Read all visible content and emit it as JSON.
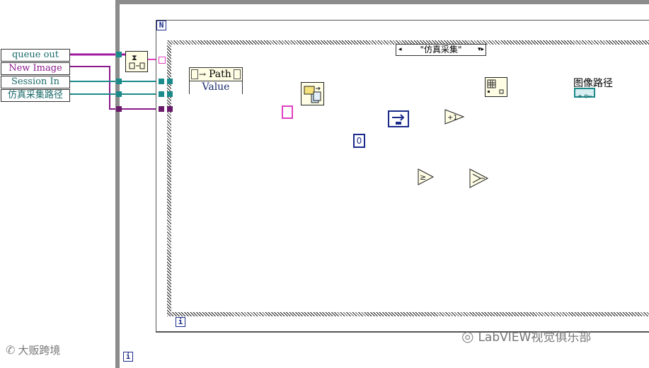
{
  "cluster": {
    "items": [
      "queue out",
      "New Image",
      "Session In",
      "仿真采集路径"
    ]
  },
  "loop_labels": {
    "for_loop_N": "N",
    "inner_index": "i",
    "outer_index": "i"
  },
  "case_selector": {
    "value": "\"仿真采集\"",
    "left_arrow": "◂",
    "right_arrow": "▾▸"
  },
  "property_node": {
    "title": "Path",
    "property": "Value"
  },
  "constant": {
    "value": "0"
  },
  "indicator": {
    "label": "图像路径"
  },
  "watermarks": {
    "left": "大贩跨境",
    "right": "LabVIEW视觉俱乐部"
  },
  "colors": {
    "path_wire": "#1a8a8a",
    "int_wire": "#1a2a8a",
    "refnum_wire": "#8a1a8a",
    "pink_wire": "#e040c0",
    "cluster_wire": "#8a1a8a",
    "node_bg": "#fffde4"
  }
}
